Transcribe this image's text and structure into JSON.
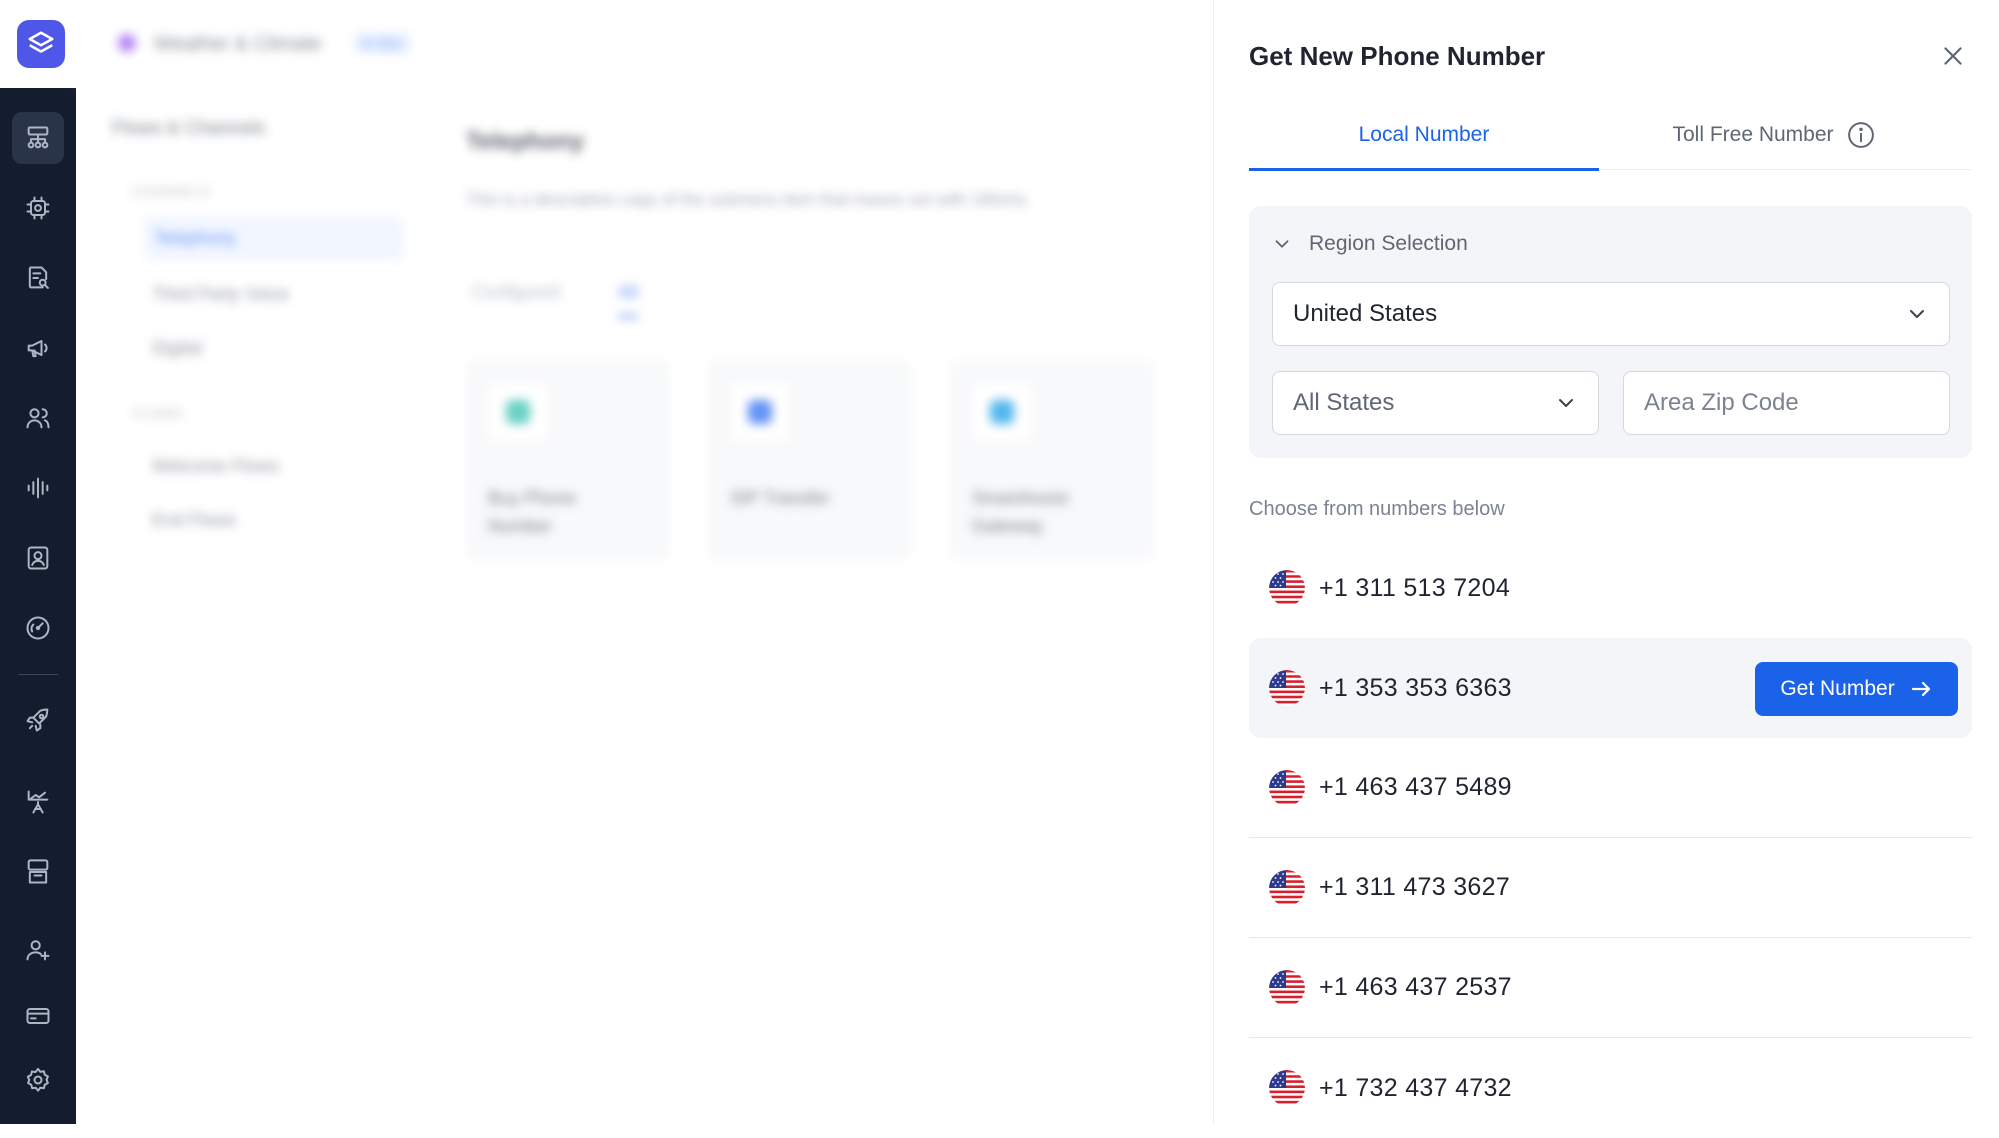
{
  "background": {
    "workspace_name": "Weather & Climate",
    "workspace_badge": "In Dev",
    "sidebar_title": "Flows & Channels",
    "groups": [
      {
        "label": "CHANNELS",
        "items": [
          "Telephony",
          "Third Party Voice",
          "Digital"
        ]
      },
      {
        "label": "FLOWS",
        "items": [
          "Welcome Flows",
          "End Flows"
        ]
      }
    ],
    "main_title": "Telephony",
    "main_description": "This is a description copy of the submenu item that maxes out with 180chs",
    "tabs": [
      "Configured",
      "All"
    ],
    "cards": [
      "Buy Phone Number",
      "SIP Transfer",
      "SmartAssist Gateway"
    ]
  },
  "rail": {
    "icons": [
      "flows-icon",
      "chip-icon",
      "document-search-icon",
      "megaphone-icon",
      "users-icon",
      "waveform-icon",
      "contact-card-icon",
      "gauge-icon",
      "rocket-icon",
      "analytics-icon",
      "archive-icon",
      "add-user-icon",
      "billing-card-icon",
      "settings-icon"
    ]
  },
  "panel": {
    "title": "Get New Phone Number",
    "tabs": {
      "local": "Local Number",
      "toll_free": "Toll Free Number"
    },
    "region": {
      "heading": "Region Selection",
      "country": "United States",
      "state": "All States",
      "zip_placeholder": "Area Zip Code"
    },
    "choose_label": "Choose from numbers below",
    "numbers": [
      "+1 311 513 7204",
      "+1 353 353 6363",
      "+1 463 437 5489",
      "+1 311 473 3627",
      "+1 463 437 2537",
      "+1 732 437 4732"
    ],
    "get_number_label": "Get Number"
  },
  "colors": {
    "accent": "#1a63e8",
    "rail_bg": "#141d2e",
    "logo": "#4f57e8"
  }
}
